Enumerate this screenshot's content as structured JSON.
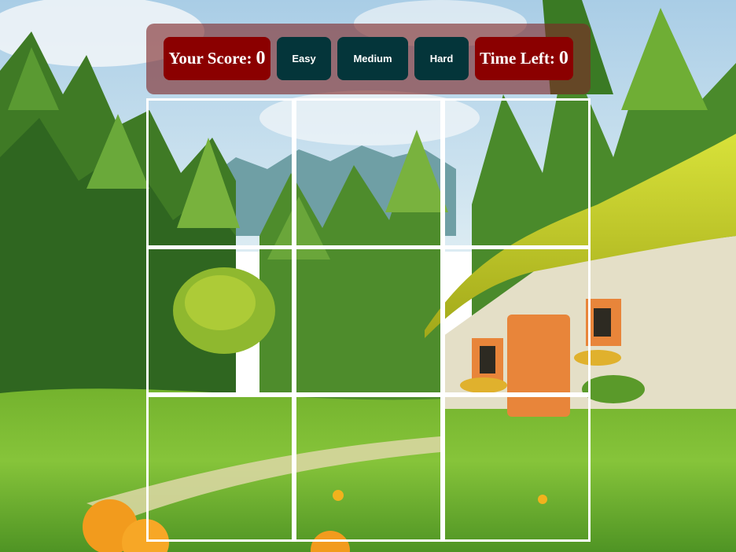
{
  "controls": {
    "score_label": "Your Score:",
    "score_value": "0",
    "easy_label": "Easy",
    "medium_label": "Medium",
    "hard_label": "Hard",
    "time_label": "Time Left:",
    "time_value": "0"
  },
  "puzzle": {
    "tiles": [
      "tile-1",
      "tile-2",
      "tile-3",
      "tile-4",
      "tile-5",
      "tile-6",
      "tile-7",
      "tile-8",
      "tile-9"
    ]
  },
  "colors": {
    "control_bar": "#802828",
    "score_panel": "#8b0000",
    "level_button": "#04353a",
    "grid_line": "#ffffff"
  }
}
